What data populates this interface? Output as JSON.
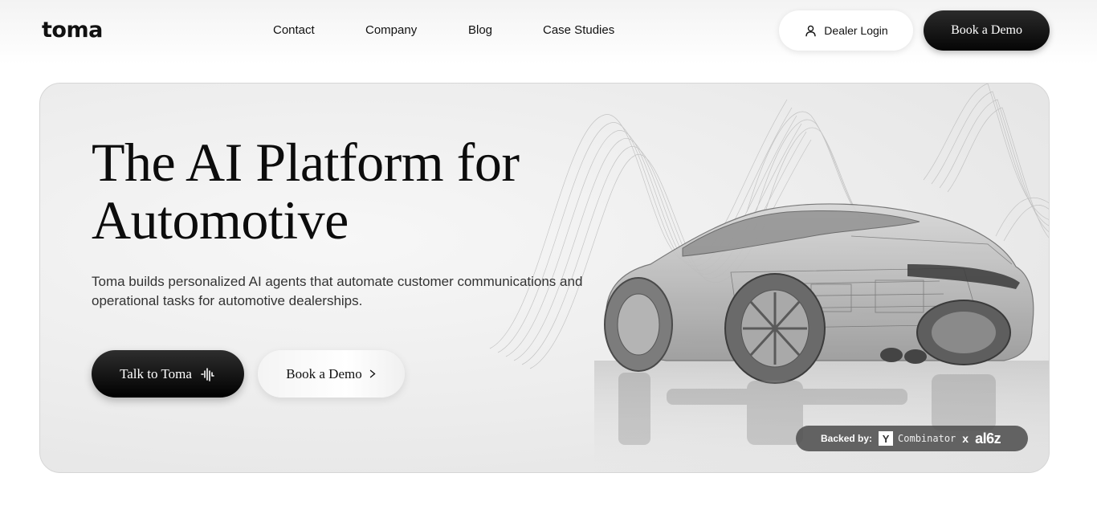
{
  "brand": {
    "logo_text": "toma"
  },
  "nav": {
    "links": [
      "Contact",
      "Company",
      "Blog",
      "Case Studies"
    ],
    "dealer_login_label": "Dealer Login",
    "book_demo_label": "Book a Demo"
  },
  "hero": {
    "title": "The AI Platform for Automotive",
    "description": "Toma builds personalized AI agents that automate customer communications and operational tasks for automotive dealerships.",
    "talk_button_label": "Talk to Toma",
    "book_demo_label": "Book a Demo",
    "backed_by": {
      "label": "Backed by:",
      "yc_letter": "Y",
      "yc_text": "Combinator",
      "separator": "x",
      "investor2": "al6z"
    }
  },
  "colors": {
    "primary_button": "#0a0a0a",
    "background": "#ffffff",
    "hero_bg": "#ececec"
  },
  "icons": [
    "user-icon",
    "sound-wave-icon",
    "chevron-right-icon"
  ]
}
